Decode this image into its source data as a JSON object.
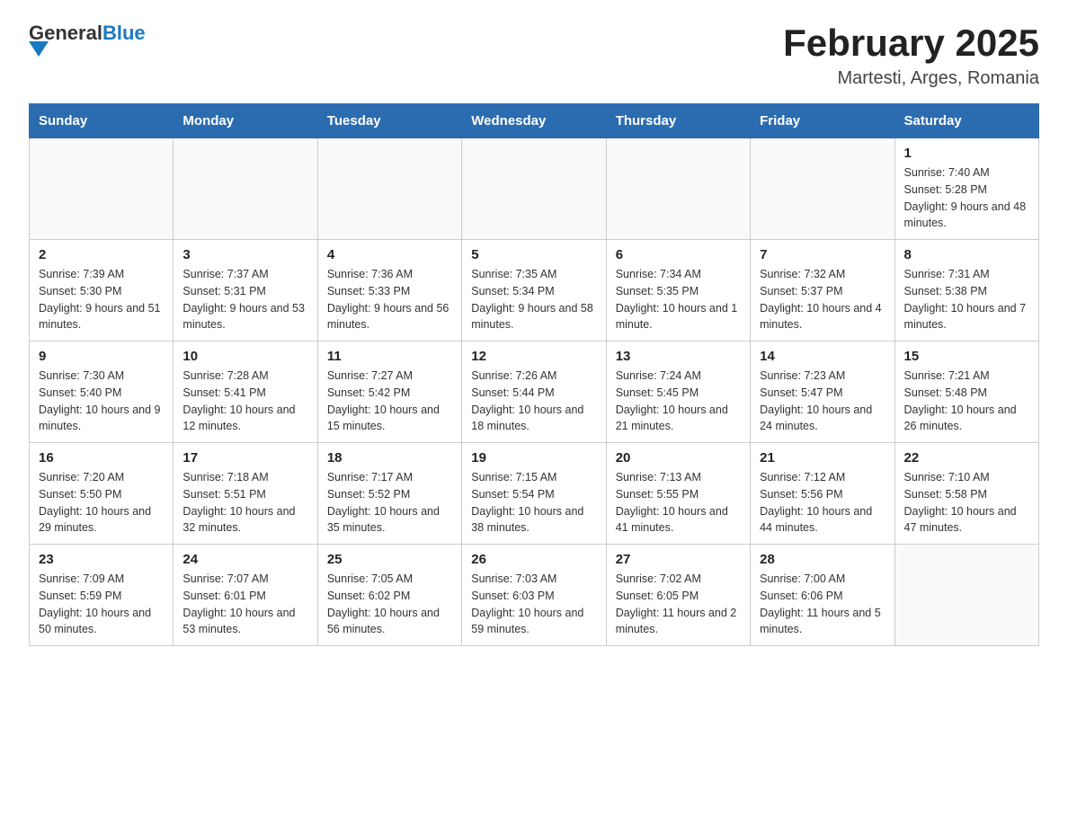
{
  "logo": {
    "text_general": "General",
    "text_blue": "Blue"
  },
  "title": "February 2025",
  "subtitle": "Martesti, Arges, Romania",
  "days_of_week": [
    "Sunday",
    "Monday",
    "Tuesday",
    "Wednesday",
    "Thursday",
    "Friday",
    "Saturday"
  ],
  "weeks": [
    [
      {
        "day": "",
        "info": ""
      },
      {
        "day": "",
        "info": ""
      },
      {
        "day": "",
        "info": ""
      },
      {
        "day": "",
        "info": ""
      },
      {
        "day": "",
        "info": ""
      },
      {
        "day": "",
        "info": ""
      },
      {
        "day": "1",
        "info": "Sunrise: 7:40 AM\nSunset: 5:28 PM\nDaylight: 9 hours and 48 minutes."
      }
    ],
    [
      {
        "day": "2",
        "info": "Sunrise: 7:39 AM\nSunset: 5:30 PM\nDaylight: 9 hours and 51 minutes."
      },
      {
        "day": "3",
        "info": "Sunrise: 7:37 AM\nSunset: 5:31 PM\nDaylight: 9 hours and 53 minutes."
      },
      {
        "day": "4",
        "info": "Sunrise: 7:36 AM\nSunset: 5:33 PM\nDaylight: 9 hours and 56 minutes."
      },
      {
        "day": "5",
        "info": "Sunrise: 7:35 AM\nSunset: 5:34 PM\nDaylight: 9 hours and 58 minutes."
      },
      {
        "day": "6",
        "info": "Sunrise: 7:34 AM\nSunset: 5:35 PM\nDaylight: 10 hours and 1 minute."
      },
      {
        "day": "7",
        "info": "Sunrise: 7:32 AM\nSunset: 5:37 PM\nDaylight: 10 hours and 4 minutes."
      },
      {
        "day": "8",
        "info": "Sunrise: 7:31 AM\nSunset: 5:38 PM\nDaylight: 10 hours and 7 minutes."
      }
    ],
    [
      {
        "day": "9",
        "info": "Sunrise: 7:30 AM\nSunset: 5:40 PM\nDaylight: 10 hours and 9 minutes."
      },
      {
        "day": "10",
        "info": "Sunrise: 7:28 AM\nSunset: 5:41 PM\nDaylight: 10 hours and 12 minutes."
      },
      {
        "day": "11",
        "info": "Sunrise: 7:27 AM\nSunset: 5:42 PM\nDaylight: 10 hours and 15 minutes."
      },
      {
        "day": "12",
        "info": "Sunrise: 7:26 AM\nSunset: 5:44 PM\nDaylight: 10 hours and 18 minutes."
      },
      {
        "day": "13",
        "info": "Sunrise: 7:24 AM\nSunset: 5:45 PM\nDaylight: 10 hours and 21 minutes."
      },
      {
        "day": "14",
        "info": "Sunrise: 7:23 AM\nSunset: 5:47 PM\nDaylight: 10 hours and 24 minutes."
      },
      {
        "day": "15",
        "info": "Sunrise: 7:21 AM\nSunset: 5:48 PM\nDaylight: 10 hours and 26 minutes."
      }
    ],
    [
      {
        "day": "16",
        "info": "Sunrise: 7:20 AM\nSunset: 5:50 PM\nDaylight: 10 hours and 29 minutes."
      },
      {
        "day": "17",
        "info": "Sunrise: 7:18 AM\nSunset: 5:51 PM\nDaylight: 10 hours and 32 minutes."
      },
      {
        "day": "18",
        "info": "Sunrise: 7:17 AM\nSunset: 5:52 PM\nDaylight: 10 hours and 35 minutes."
      },
      {
        "day": "19",
        "info": "Sunrise: 7:15 AM\nSunset: 5:54 PM\nDaylight: 10 hours and 38 minutes."
      },
      {
        "day": "20",
        "info": "Sunrise: 7:13 AM\nSunset: 5:55 PM\nDaylight: 10 hours and 41 minutes."
      },
      {
        "day": "21",
        "info": "Sunrise: 7:12 AM\nSunset: 5:56 PM\nDaylight: 10 hours and 44 minutes."
      },
      {
        "day": "22",
        "info": "Sunrise: 7:10 AM\nSunset: 5:58 PM\nDaylight: 10 hours and 47 minutes."
      }
    ],
    [
      {
        "day": "23",
        "info": "Sunrise: 7:09 AM\nSunset: 5:59 PM\nDaylight: 10 hours and 50 minutes."
      },
      {
        "day": "24",
        "info": "Sunrise: 7:07 AM\nSunset: 6:01 PM\nDaylight: 10 hours and 53 minutes."
      },
      {
        "day": "25",
        "info": "Sunrise: 7:05 AM\nSunset: 6:02 PM\nDaylight: 10 hours and 56 minutes."
      },
      {
        "day": "26",
        "info": "Sunrise: 7:03 AM\nSunset: 6:03 PM\nDaylight: 10 hours and 59 minutes."
      },
      {
        "day": "27",
        "info": "Sunrise: 7:02 AM\nSunset: 6:05 PM\nDaylight: 11 hours and 2 minutes."
      },
      {
        "day": "28",
        "info": "Sunrise: 7:00 AM\nSunset: 6:06 PM\nDaylight: 11 hours and 5 minutes."
      },
      {
        "day": "",
        "info": ""
      }
    ]
  ]
}
